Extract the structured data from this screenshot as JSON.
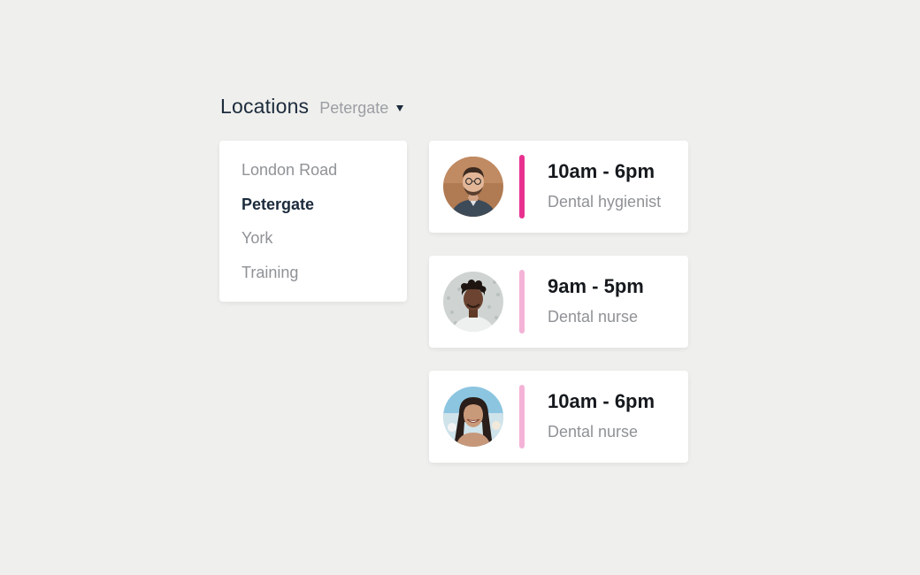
{
  "header": {
    "title": "Locations",
    "selected_location": "Petergate",
    "dropdown_icon": "chevron-down-icon"
  },
  "locations_menu": {
    "items": [
      {
        "label": "London Road",
        "active": false
      },
      {
        "label": "Petergate",
        "active": true
      },
      {
        "label": "York",
        "active": false
      },
      {
        "label": "Training",
        "active": false
      }
    ]
  },
  "shifts": [
    {
      "time": "10am - 6pm",
      "role": "Dental hygienist",
      "accent_color": "#e8318f",
      "avatar": "avatar-man-glasses"
    },
    {
      "time": "9am - 5pm",
      "role": "Dental nurse",
      "accent_color": "#f4b3d6",
      "avatar": "avatar-man-curly-hair"
    },
    {
      "time": "10am - 6pm",
      "role": "Dental nurse",
      "accent_color": "#f4b3d6",
      "avatar": "avatar-woman-smiling"
    }
  ],
  "colors": {
    "background": "#efefed",
    "heading": "#1c2b3c",
    "muted_text": "#8f9296",
    "primary_accent": "#e8318f",
    "secondary_accent": "#f4b3d6"
  }
}
